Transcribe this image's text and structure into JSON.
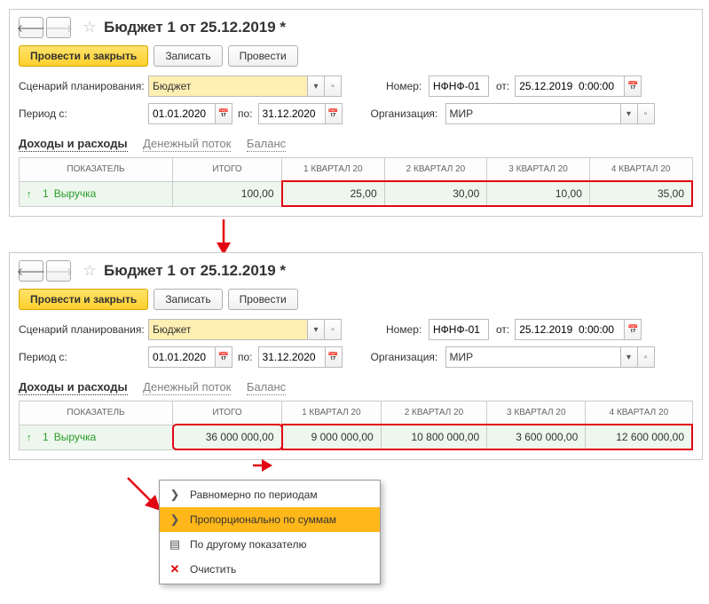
{
  "common": {
    "title": "Бюджет 1 от 25.12.2019 *",
    "buttons": {
      "post_close": "Провести и закрыть",
      "save": "Записать",
      "post": "Провести"
    },
    "fields": {
      "scenario_label": "Сценарий планирования:",
      "scenario_value": "Бюджет",
      "number_label": "Номер:",
      "number_value": "НФНФ-01",
      "from_label": "от:",
      "date_value": "25.12.2019  0:00:00",
      "period_label": "Период с:",
      "period_from": "01.01.2020",
      "period_to_label": "по:",
      "period_to": "31.12.2020",
      "org_label": "Организация:",
      "org_value": "МИР"
    },
    "tabs": {
      "tab1": "Доходы и расходы",
      "tab2": "Денежный поток",
      "tab3": "Баланс"
    },
    "table_headers": {
      "indicator": "Показатель",
      "total": "Итого",
      "q1": "1 квартал 20",
      "q2": "2 квартал 20",
      "q3": "3 квартал 20",
      "q4": "4 квартал 20"
    },
    "row_label": "Выручка",
    "row_num": "1"
  },
  "panel1": {
    "values": {
      "total": "100,00",
      "q1": "25,00",
      "q2": "30,00",
      "q3": "10,00",
      "q4": "35,00"
    }
  },
  "panel2": {
    "values": {
      "total": "36 000 000,00",
      "q1": "9 000 000,00",
      "q2": "10 800 000,00",
      "q3": "3 600 000,00",
      "q4": "12 600 000,00"
    }
  },
  "menu": {
    "item_even": "Равномерно по периодам",
    "item_prop": "Пропорционально по суммам",
    "item_other": "По другому показателю",
    "item_clear": "Очистить"
  }
}
